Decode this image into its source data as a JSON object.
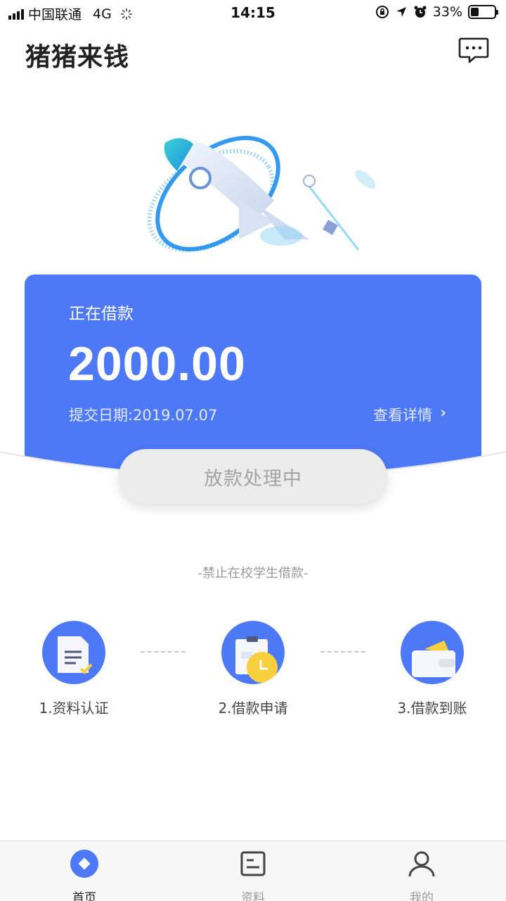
{
  "status_bar": {
    "carrier": "中国联通",
    "network": "4G",
    "time": "14:15",
    "battery": "33%",
    "battery_level": 0.33
  },
  "header": {
    "title": "猪猪来钱",
    "message_icon": "chat-bubble-icon"
  },
  "loan_card": {
    "label": "正在借款",
    "amount": "2000.00",
    "submit_date": "提交日期:2019.07.07",
    "detail_link": "查看详情",
    "chevron": "›",
    "color": "#4d79f6"
  },
  "status_button": {
    "label": "放款处理中"
  },
  "notice": "-禁止在校学生借款-",
  "steps": [
    {
      "label": "1.资料认证",
      "icon": "document-check-icon"
    },
    {
      "label": "2.借款申请",
      "icon": "clipboard-clock-icon"
    },
    {
      "label": "3.借款到账",
      "icon": "wallet-icon"
    }
  ],
  "tabs": [
    {
      "label": "首页",
      "icon": "home-diamond-icon",
      "active": true
    },
    {
      "label": "资料",
      "icon": "profile-card-icon",
      "active": false
    },
    {
      "label": "我的",
      "icon": "user-icon",
      "active": false
    }
  ],
  "colors": {
    "accent": "#4d79f6",
    "muted": "#9a9a9a",
    "yellow": "#f8cf3c"
  }
}
